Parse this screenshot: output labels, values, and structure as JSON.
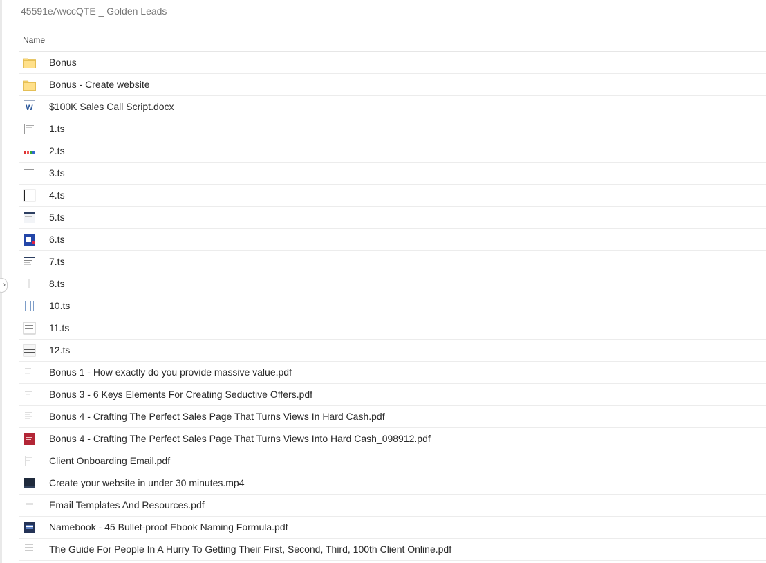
{
  "header": {
    "breadcrumb": "45591eAwccQTE _ Golden Leads"
  },
  "list": {
    "column_name": "Name",
    "items": [
      {
        "name": "Bonus",
        "icon": "folder-icon"
      },
      {
        "name": "Bonus - Create website",
        "icon": "folder-icon"
      },
      {
        "name": "$100K Sales Call Script.docx",
        "icon": "word-doc-icon"
      },
      {
        "name": "1.ts",
        "icon": "file-thumbnail-icon"
      },
      {
        "name": "2.ts",
        "icon": "file-thumbnail-icon"
      },
      {
        "name": "3.ts",
        "icon": "file-thumbnail-icon"
      },
      {
        "name": "4.ts",
        "icon": "file-thumbnail-icon"
      },
      {
        "name": "5.ts",
        "icon": "file-thumbnail-icon"
      },
      {
        "name": "6.ts",
        "icon": "file-thumbnail-icon"
      },
      {
        "name": "7.ts",
        "icon": "file-thumbnail-icon"
      },
      {
        "name": "8.ts",
        "icon": "file-thumbnail-icon"
      },
      {
        "name": "10.ts",
        "icon": "file-thumbnail-icon"
      },
      {
        "name": "11.ts",
        "icon": "file-thumbnail-icon"
      },
      {
        "name": "12.ts",
        "icon": "file-thumbnail-icon"
      },
      {
        "name": "Bonus 1 - How exactly do you provide massive value.pdf",
        "icon": "pdf-thumbnail-icon"
      },
      {
        "name": "Bonus 3 - 6 Keys Elements For Creating Seductive Offers.pdf",
        "icon": "pdf-thumbnail-icon"
      },
      {
        "name": "Bonus 4 - Crafting The Perfect Sales Page That Turns Views In Hard Cash.pdf",
        "icon": "pdf-thumbnail-icon"
      },
      {
        "name": "Bonus 4 - Crafting The Perfect Sales Page That Turns Views Into Hard Cash_098912.pdf",
        "icon": "pdf-thumbnail-icon"
      },
      {
        "name": "Client Onboarding Email.pdf",
        "icon": "pdf-thumbnail-icon"
      },
      {
        "name": "Create your website in under 30 minutes.mp4",
        "icon": "video-thumbnail-icon"
      },
      {
        "name": "Email Templates And Resources.pdf",
        "icon": "pdf-thumbnail-icon"
      },
      {
        "name": "Namebook - 45 Bullet-proof Ebook Naming Formula.pdf",
        "icon": "pdf-thumbnail-icon"
      },
      {
        "name": "The Guide For People In A Hurry To Getting Their First, Second, Third, 100th Client Online.pdf",
        "icon": "pdf-thumbnail-icon"
      }
    ]
  }
}
